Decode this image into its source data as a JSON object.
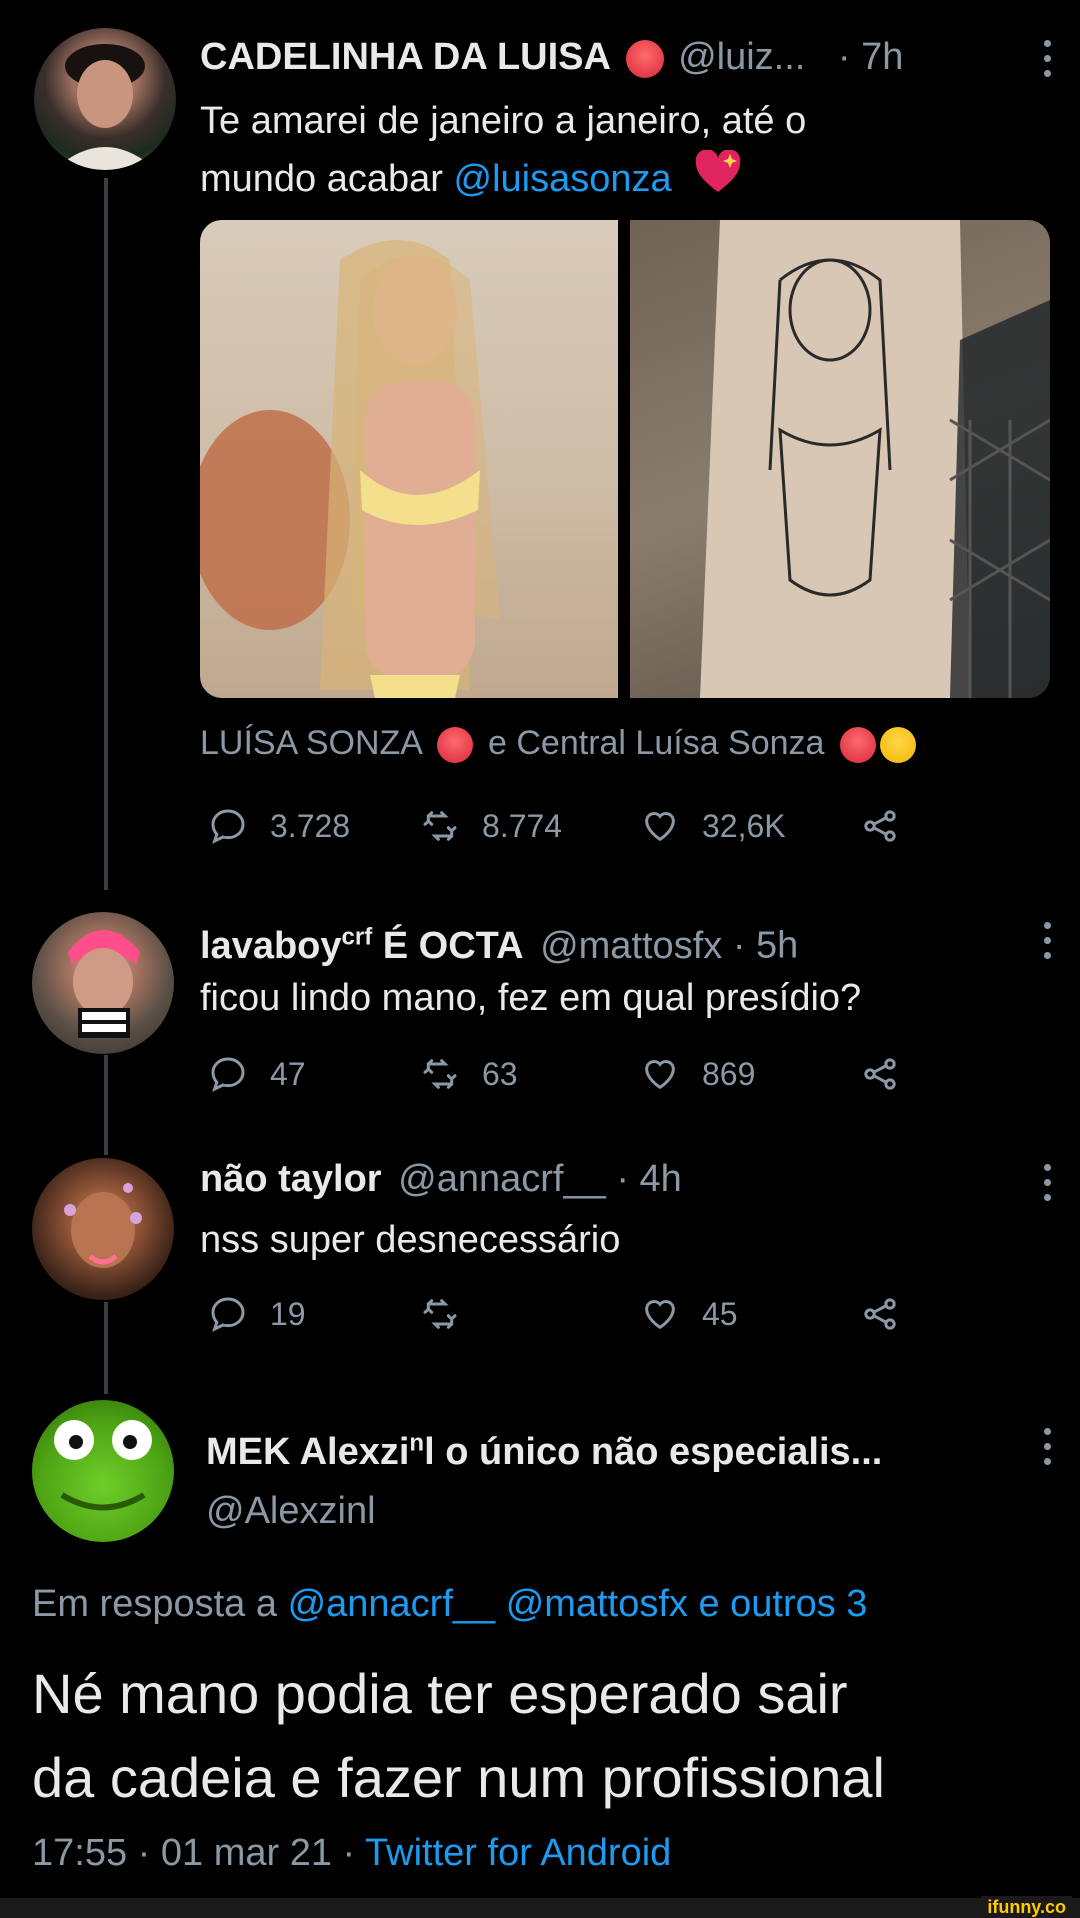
{
  "tweets": [
    {
      "name": "CADELINHA DA LUISA",
      "handle": "@luiz...",
      "time": "· 7h",
      "text_line1": "Te amarei de janeiro a janeiro, até o",
      "text_line2_prefix": "mundo acabar ",
      "mention": "@luisasonza",
      "tagged": "LUÍSA SONZA",
      "tagged_join": "e",
      "tagged_second": "Central Luísa Sonza",
      "replies": "3.728",
      "retweets": "8.774",
      "likes": "32,6K"
    },
    {
      "name": "lavaboy",
      "name_sup": "crf",
      "name_suffix": " É OCTA",
      "handle": "@mattosfx",
      "time": "· 5h",
      "text": "ficou lindo mano, fez em qual presídio?",
      "replies": "47",
      "retweets": "63",
      "likes": "869",
      "avatar_badge": "PARENTAL ADVISORY"
    },
    {
      "name": "não taylor",
      "handle": "@annacrf__",
      "time": "· 4h",
      "text": "nss super desnecessário",
      "replies": "19",
      "retweets": "",
      "likes": "45"
    }
  ],
  "focus_tweet": {
    "name": "MEK Alexzi",
    "name_sup": "n",
    "name_suffix": "l o único não especialis...",
    "handle": "@Alexzinl",
    "reply_prefix": "Em resposta a ",
    "reply_to1": "@annacrf__",
    "reply_to2": "@mattosfx e outros 3",
    "text_line1": "Né mano podia ter esperado sair",
    "text_line2": "da cadeia e fazer num profissional",
    "timestamp": "17:55 · 01 mar 21 · ",
    "source": "Twitter for Android"
  },
  "watermark": "ifunny.co",
  "colors": {
    "link": "#1d9bf0",
    "muted": "#8b98a5",
    "text": "#e7e9ea",
    "background": "#000000"
  }
}
